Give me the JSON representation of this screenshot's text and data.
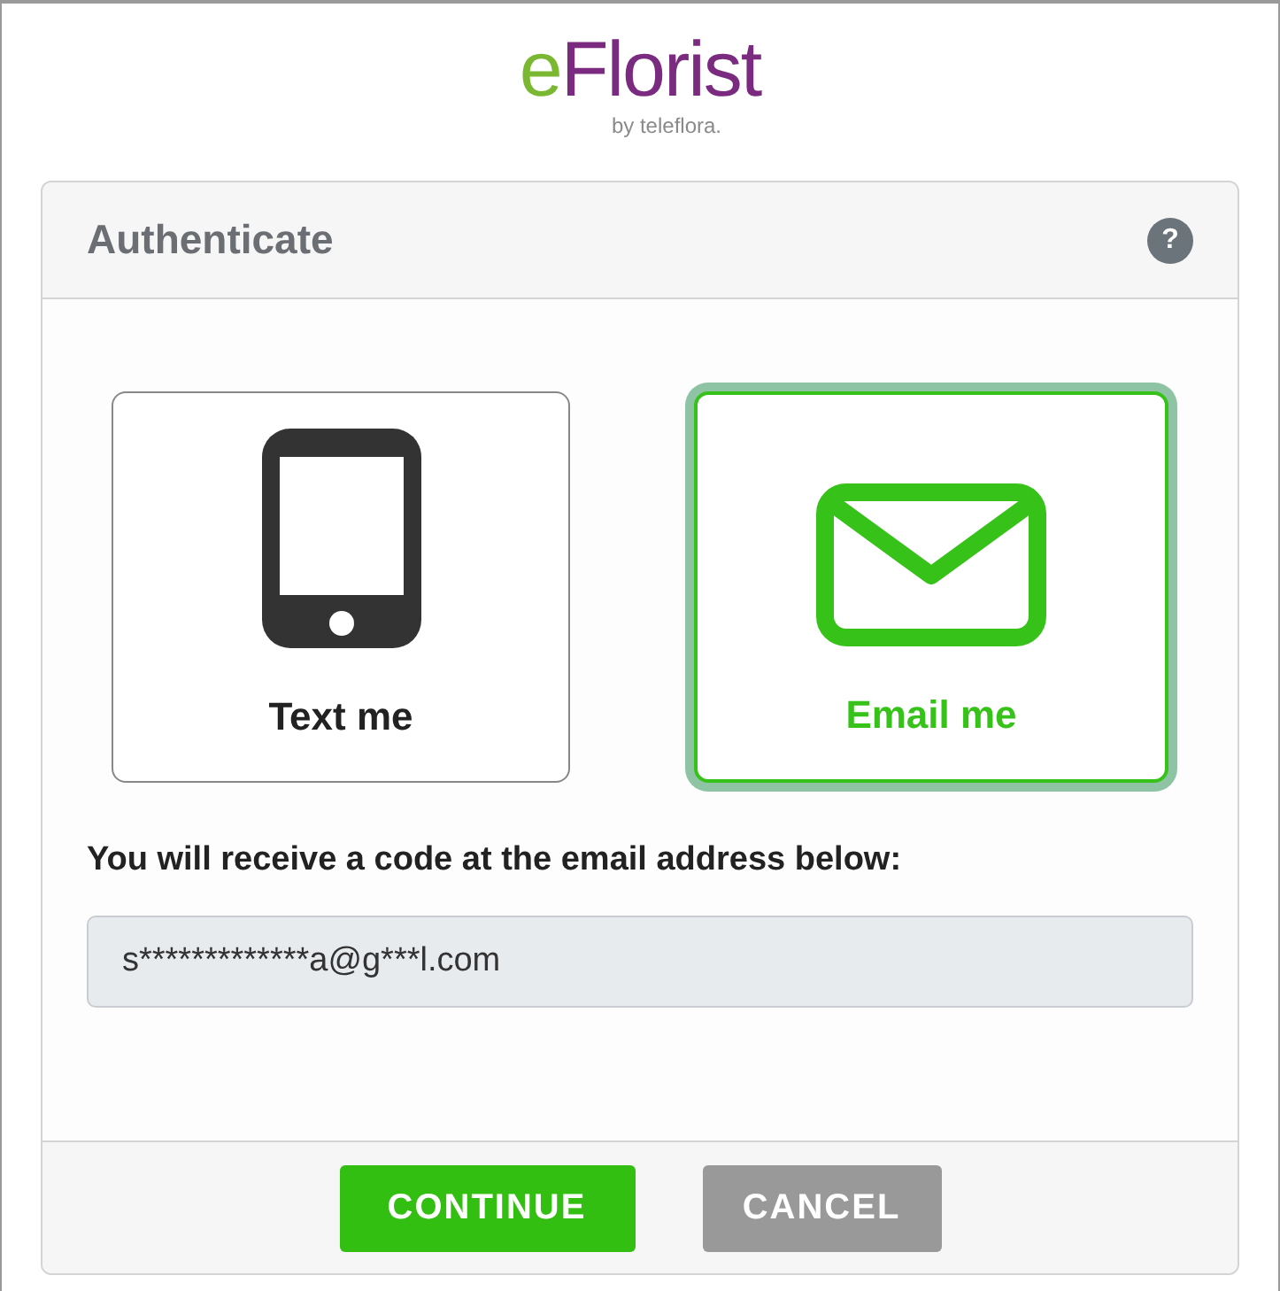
{
  "logo": {
    "parts": [
      "e",
      "Florist"
    ],
    "tagline": "by teleflora."
  },
  "dialog": {
    "title": "Authenticate",
    "help_icon": "?"
  },
  "options": [
    {
      "kind": "phone",
      "label": "Text me",
      "selected": false
    },
    {
      "kind": "email",
      "label": "Email me",
      "selected": true
    }
  ],
  "prompt": "You will receive a code at the email address below:",
  "email_field": {
    "value": "s*************a@g***l.com"
  },
  "buttons": [
    {
      "kind": "primary",
      "label": "CONTINUE"
    },
    {
      "kind": "secondary",
      "label": "CANCEL"
    }
  ]
}
